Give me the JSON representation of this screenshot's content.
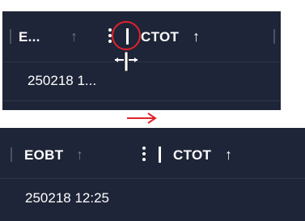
{
  "before": {
    "header": {
      "col1_label": "E...",
      "col2_label": "CTOT"
    },
    "row": {
      "cell_value": "250218 1..."
    }
  },
  "after": {
    "header": {
      "col1_label": "EOBT",
      "col2_label": "CTOT"
    },
    "row": {
      "cell_value": "250218 12:25"
    }
  },
  "icons": {
    "sort_up": "↑",
    "transition": "right-arrow-icon",
    "resize": "column-resize-cursor-icon",
    "menu": "kebab-menu-icon"
  },
  "colors": {
    "panel_bg": "#1f2538",
    "highlight": "#e0222a",
    "dim_arrow": "#6e7486"
  }
}
